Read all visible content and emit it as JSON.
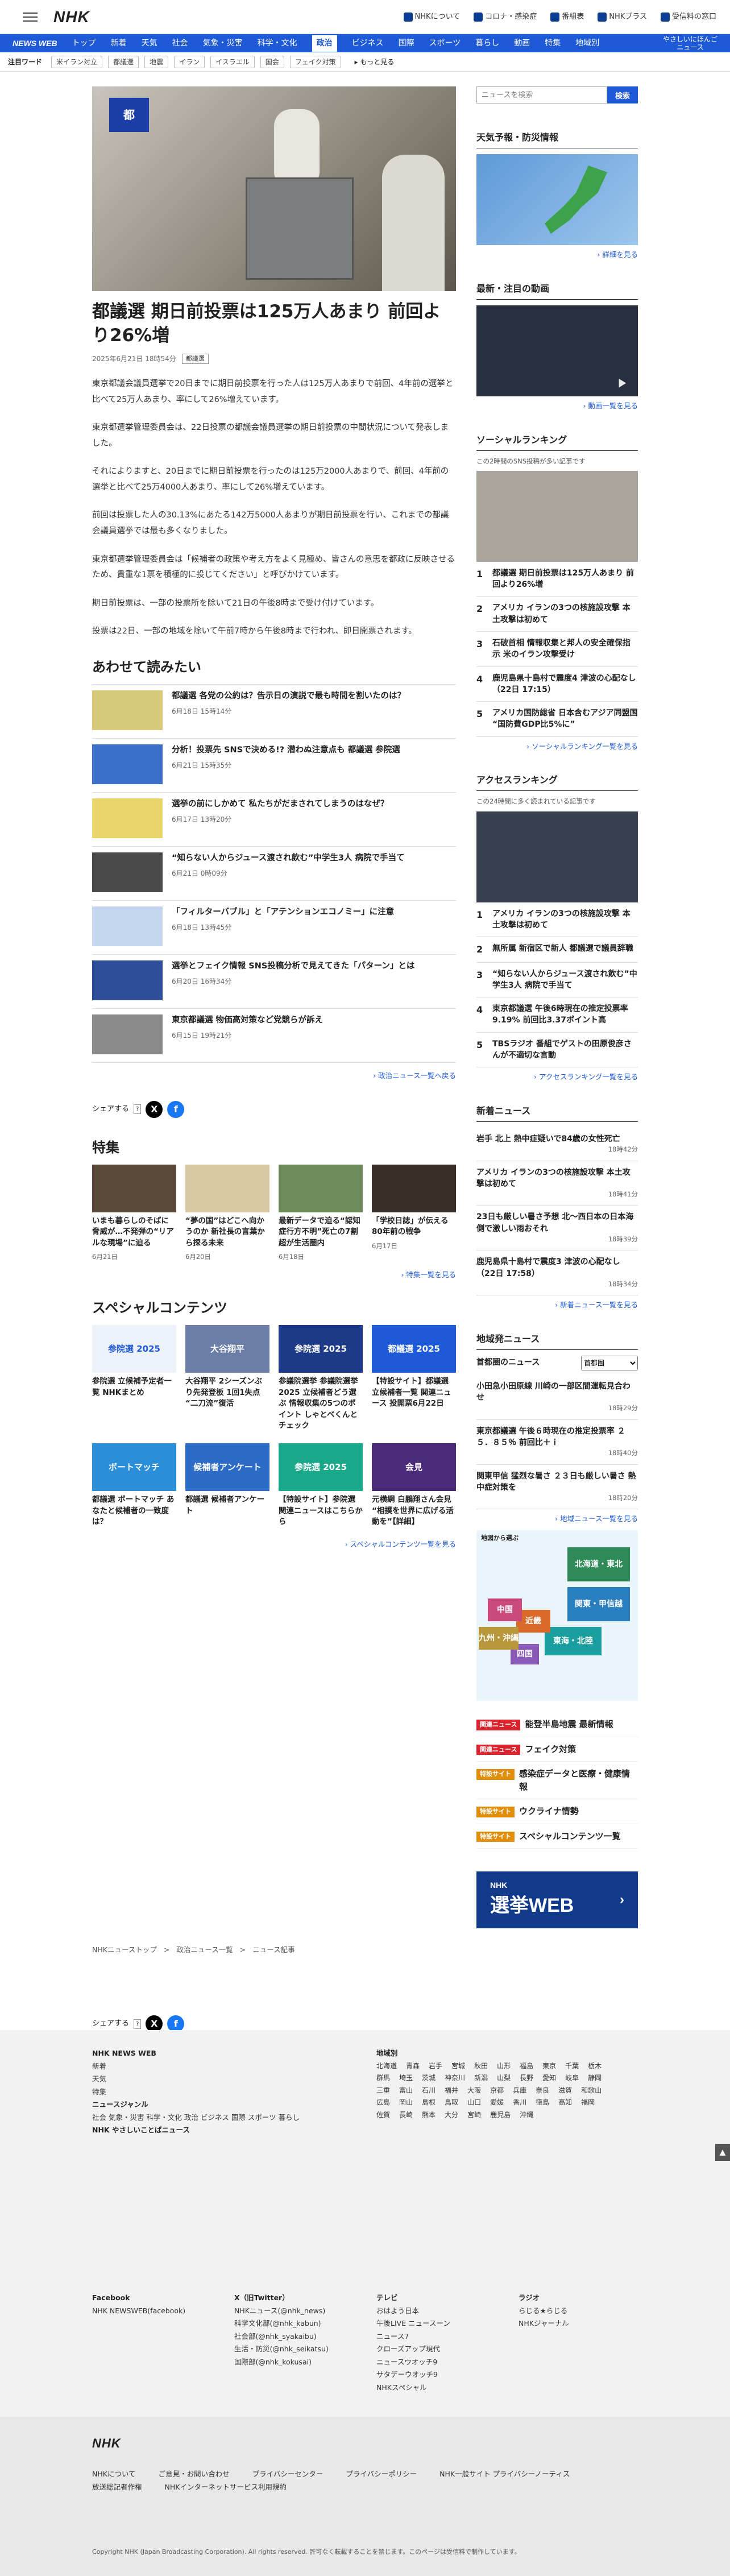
{
  "header": {
    "logo": "NHK",
    "links": [
      "NHKについて",
      "コロナ・感染症",
      "番組表",
      "NHKプラス",
      "受信料の窓口"
    ]
  },
  "nav": {
    "brand": "NEWS WEB",
    "items": [
      "トップ",
      "新着",
      "天気",
      "社会",
      "気象・災害",
      "科学・文化",
      "政治",
      "ビジネス",
      "国際",
      "スポーツ",
      "暮らし",
      "動画",
      "特集",
      "地域別"
    ],
    "active_index": 6,
    "easy": "やさしいにほんご\nニュース"
  },
  "keywords": {
    "label": "注目ワード",
    "items": [
      "米イラン対立",
      "都議選",
      "地震",
      "イラン",
      "イスラエル",
      "国会",
      "フェイク対策"
    ],
    "more": "もっと見る"
  },
  "article": {
    "hero_sign": "都",
    "title": "都議選 期日前投票は125万人あまり 前回より26%増",
    "date": "2025年6月21日 18時54分",
    "tag": "都議選",
    "paragraphs": [
      "東京都議会議員選挙で20日までに期日前投票を行った人は125万人あまりで前回、4年前の選挙と比べて25万人あまり、率にして26%増えています。",
      "東京都選挙管理委員会は、22日投票の都議会議員選挙の期日前投票の中間状況について発表しました。",
      "それによりますと、20日までに期日前投票を行ったのは125万2000人あまりで、前回、4年前の選挙と比べて25万4000人あまり、率にして26%増えています。",
      "前回は投票した人の30.13%にあたる142万5000人あまりが期日前投票を行い、これまでの都議会議員選挙では最も多くなりました。",
      "東京都選挙管理委員会は「候補者の政策や考え方をよく見極め、皆さんの意思を都政に反映させるため、貴重な1票を積極的に投じてください」と呼びかけています。",
      "期日前投票は、一部の投票所を除いて21日の午後8時まで受け付けています。",
      "投票は22日、一部の地域を除いて午前7時から午後8時まで行われ、即日開票されます。"
    ]
  },
  "related": {
    "heading": "あわせて読みたい",
    "items": [
      {
        "title": "都議選 各党の公約は？告示日の演説で最も時間を割いたのは？",
        "date": "6月18日 15時14分"
      },
      {
        "title": "分析！投票先 SNSで決める!? 潜わぬ注意点も 都議選 参院選",
        "date": "6月21日 15時35分"
      },
      {
        "title": "選挙の前にしかめて 私たちがだまされてしまうのはなぜ？",
        "date": "6月17日 13時20分"
      },
      {
        "title": "“知らない人からジュース渡され飲む”中学生3人 病院で手当て",
        "date": "6月21日 0時09分"
      },
      {
        "title": "「フィルターバブル」と「アテンションエコノミー」に注意",
        "date": "6月18日 13時45分"
      },
      {
        "title": "選挙とフェイク情報 SNS投稿分析で見えてきた「パターン」とは",
        "date": "6月20日 16時34分"
      },
      {
        "title": "東京都議選 物価高対策など党競らが訴え",
        "date": "6月15日 19時21分"
      }
    ],
    "more": "政治ニュース一覧へ戻る"
  },
  "share": {
    "label": "シェアする"
  },
  "features": {
    "heading": "特集",
    "items": [
      {
        "title": "いまも暮らしのそばに脅威が…不発弾の“リアルな現場”に迫る",
        "date": "6月21日"
      },
      {
        "title": "“夢の国”はどこへ向かうのか 新社長の言葉から探る未来",
        "date": "6月20日"
      },
      {
        "title": "最新データで迫る“認知症行方不明”死亡の7割超が生活圏内",
        "date": "6月18日"
      },
      {
        "title": "「学校日誌」が伝える80年前の戦争",
        "date": "6月17日"
      }
    ],
    "more": "特集一覧を見る"
  },
  "special": {
    "heading": "スペシャルコンテンツ",
    "items": [
      {
        "img": "参院選 2025",
        "title": "参院選 立候補予定者一覧 NHKまとめ"
      },
      {
        "img": "大谷翔平",
        "title": "大谷翔平 2シーズンぶり先発登板 1回1失点 “二刀流”復活"
      },
      {
        "img": "参院選 2025",
        "title": "参議院選挙 参議院選挙 2025 立候補者どう選ぶ 情報収集の5つのポイント しゃとべくんとチェック"
      },
      {
        "img": "都議選 2025",
        "title": "【特設サイト】都議選 立候補者一覧 関連ニュース 投開票6月22日"
      },
      {
        "img": "ボートマッチ",
        "title": "都議選 ボートマッチ あなたと候補者の一致度は？"
      },
      {
        "img": "候補者アンケート",
        "title": "都議選 候補者アンケート"
      },
      {
        "img": "参院選 2025",
        "title": "【特設サイト】参院選 関連ニュースはこちらから"
      },
      {
        "img": "会見",
        "title": "元横綱 白鵬翔さん会見 “相撲を世界に広げる活動を”【詳細】"
      }
    ],
    "more": "スペシャルコンテンツ一覧を見る"
  },
  "breadcrumb": [
    "NHKニューストップ",
    "政治ニュース一覧",
    "ニュース記事"
  ],
  "sidebar": {
    "search_placeholder": "ニュースを検索",
    "search_button": "検索",
    "weather": {
      "heading": "天気予報・防災情報",
      "more": "詳細を見る"
    },
    "video": {
      "heading": "最新・注目の動画",
      "more": "動画一覧を見る"
    },
    "social": {
      "heading": "ソーシャルランキング",
      "note": "この2時間のSNS投稿が多い記事です",
      "items": [
        "都議選 期日前投票は125万人あまり 前回より26%増",
        "アメリカ イランの3つの核施設攻撃 本土攻撃は初めて",
        "石破首相 情報収集と邦人の安全確保指示 米のイラン攻撃受け",
        "鹿児島県十島村で震度4 津波の心配なし（22日 17:15）",
        "アメリカ国防総省 日本含むアジア同盟国 “国防費GDP比5%に”"
      ],
      "more": "ソーシャルランキング一覧を見る"
    },
    "access": {
      "heading": "アクセスランキング",
      "note": "この24時間に多く読まれている記事です",
      "items": [
        "アメリカ イランの3つの核施設攻撃 本土攻撃は初めて",
        "無所属 新宿区で新人 都議選で議員辞職",
        "“知らない人からジュース渡され飲む”中学生3人 病院で手当て",
        "東京都議選 午後6時現在の推定投票率 9.19% 前回比3.37ポイント高",
        "TBSラジオ 番組でゲストの田原俊彦さんが不適切な言動"
      ],
      "more": "アクセスランキング一覧を見る"
    },
    "news": {
      "heading": "新着ニュース",
      "items": [
        {
          "title": "岩手 北上 熱中症疑いで84歳の女性死亡",
          "date": "18時42分"
        },
        {
          "title": "アメリカ イランの3つの核施設攻撃 本土攻撃は初めて",
          "date": "18時41分"
        },
        {
          "title": "23日も厳しい暑さ予想 北～西日本の日本海側で激しい雨おそれ",
          "date": "18時39分"
        },
        {
          "title": "鹿児島県十島村で震度3 津波の心配なし（22日 17:58）",
          "date": "18時34分"
        }
      ],
      "more": "新着ニュース一覧を見る"
    },
    "local": {
      "heading": "地域発ニュース",
      "region": "首都圏のニュース",
      "select": "首都圏",
      "items": [
        {
          "title": "小田急小田原線 川崎の一部区間運転見合わせ",
          "date": "18時29分"
        },
        {
          "title": "東京都議選 午後６時現在の推定投票率 ２５．８５％ 前回比＋ｉ",
          "date": "18時40分"
        },
        {
          "title": "関東甲信 猛烈な暑さ ２３日も厳しい暑さ 熱中症対策を",
          "date": "18時20分"
        }
      ],
      "more": "地域ニュース一覧を見る",
      "map_title": "地図から選ぶ",
      "regions": [
        "北海道・東北",
        "関東・甲信越",
        "東海・北陸",
        "近畿",
        "中国",
        "四国",
        "九州・沖縄"
      ]
    },
    "bulletins": [
      {
        "badge": "関連ニュース",
        "color": "#d9232d",
        "title": "能登半島地震 最新情報"
      },
      {
        "badge": "関連ニュース",
        "color": "#d9232d",
        "title": "フェイク対策"
      },
      {
        "badge": "特設サイト",
        "color": "#e08e0b",
        "title": "感染症データと医療・健康情報"
      },
      {
        "badge": "特設サイト",
        "color": "#e08e0b",
        "title": "ウクライナ情勢"
      },
      {
        "badge": "特設サイト",
        "color": "#e08e0b",
        "title": "スペシャルコンテンツ一覧"
      }
    ],
    "banner": {
      "top": "NHK",
      "main": "選挙WEB"
    }
  },
  "footer": {
    "col1_title": "NHK NEWS WEB",
    "col1": [
      "新着",
      "天気",
      "特集",
      "ニュースジャンル",
      "社会 気象・災害 科学・文化 政治 ビジネス 国際 スポーツ 暮らし",
      "NHK やさしいことばニュース"
    ],
    "regional_title": "地域別",
    "prefs": [
      "北海道",
      "青森",
      "岩手",
      "宮城",
      "秋田",
      "山形",
      "福島",
      "東京",
      "千葉",
      "栃木",
      "群馬",
      "埼玉",
      "茨城",
      "神奈川",
      "新潟",
      "山梨",
      "長野",
      "愛知",
      "岐阜",
      "静岡",
      "三重",
      "富山",
      "石川",
      "福井",
      "大阪",
      "京都",
      "兵庫",
      "奈良",
      "滋賀",
      "和歌山",
      "広島",
      "岡山",
      "島根",
      "鳥取",
      "山口",
      "愛媛",
      "香川",
      "徳島",
      "高知",
      "福岡",
      "佐賀",
      "長崎",
      "熊本",
      "大分",
      "宮崎",
      "鹿児島",
      "沖縄"
    ],
    "social": [
      {
        "h": "Facebook",
        "items": [
          "NHK NEWSWEB(facebook)"
        ]
      },
      {
        "h": "X（旧Twitter）",
        "items": [
          "NHKニュース(@nhk_news)",
          "科学文化部(@nhk_kabun)",
          "社会部(@nhk_syakaibu)",
          "生活・防災(@nhk_seikatsu)",
          "国際部(@nhk_kokusai)"
        ]
      },
      {
        "h": "テレビ",
        "items": [
          "おはよう日本",
          "午後LIVE ニュースーン",
          "ニュース7",
          "クローズアップ現代",
          "ニュースウオッチ9",
          "サタデーウオッチ9",
          "NHKスペシャル"
        ]
      },
      {
        "h": "ラジオ",
        "items": [
          "らじる★らじる",
          "NHKジャーナル"
        ]
      }
    ],
    "bottom_logo": "NHK",
    "bottom_links": [
      "NHKについて",
      "ご意見・お問い合わせ",
      "プライバシーセンター",
      "プライバシーポリシー",
      "NHK一般サイト プライバシーノーティス",
      "放送総記者作権",
      "NHKインターネットサービス利用規約"
    ],
    "copyright": "Copyright NHK (Japan Broadcasting Corporation). All rights reserved. 許可なく転載することを禁じます。このページは受信料で制作しています。"
  }
}
